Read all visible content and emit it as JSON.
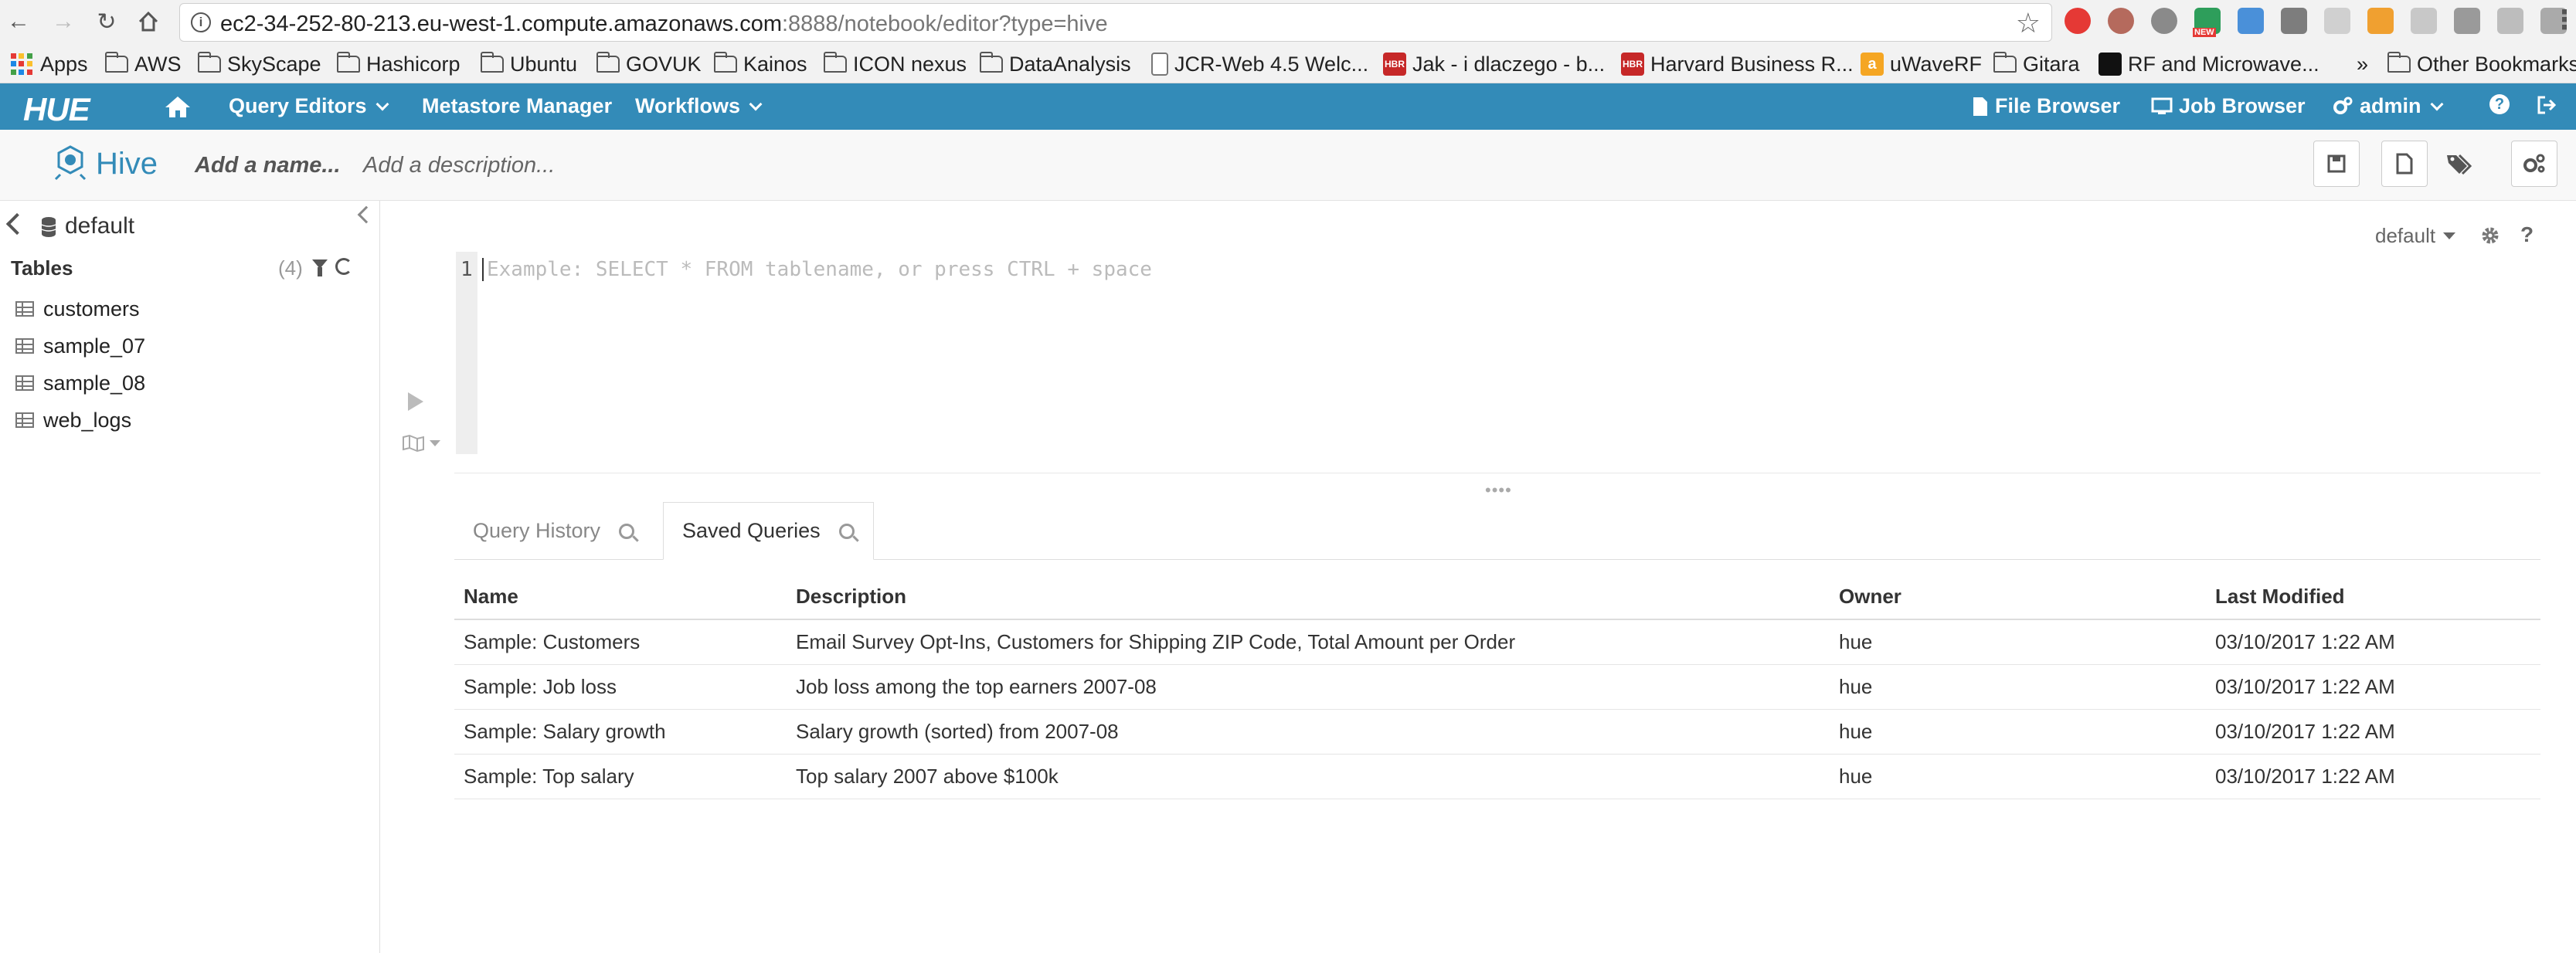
{
  "browser": {
    "url_host": "ec2-34-252-80-213.eu-west-1.compute.amazonaws.com",
    "url_rest": ":8888/notebook/editor?type=hive",
    "bookmarks": [
      {
        "label": "Apps",
        "kind": "apps"
      },
      {
        "label": "AWS",
        "kind": "folder"
      },
      {
        "label": "SkyScape",
        "kind": "folder"
      },
      {
        "label": "Hashicorp",
        "kind": "folder"
      },
      {
        "label": "Ubuntu",
        "kind": "folder"
      },
      {
        "label": "GOVUK",
        "kind": "folder"
      },
      {
        "label": "Kainos",
        "kind": "folder"
      },
      {
        "label": "ICON nexus",
        "kind": "folder"
      },
      {
        "label": "DataAnalysis",
        "kind": "folder"
      },
      {
        "label": "JCR-Web 4.5 Welc...",
        "kind": "page"
      },
      {
        "label": "Jak - i dlaczego - b...",
        "kind": "hbr"
      },
      {
        "label": "Harvard Business R...",
        "kind": "hbr"
      },
      {
        "label": "uWaveRF",
        "kind": "amazon"
      },
      {
        "label": "Gitara",
        "kind": "folder"
      },
      {
        "label": "RF and Microwave...",
        "kind": "dl"
      }
    ],
    "overflow": "»",
    "other_bookmarks": "Other Bookmarks",
    "hbr_badge": "HBR",
    "new_badge": "NEW"
  },
  "hue_nav": {
    "logo": "HUE",
    "query_editors": "Query Editors",
    "metastore_manager": "Metastore Manager",
    "workflows": "Workflows",
    "file_browser": "File Browser",
    "job_browser": "Job Browser",
    "user": "admin",
    "help": "?"
  },
  "editor_header": {
    "title": "Hive",
    "name_placeholder": "Add a name...",
    "description_placeholder": "Add a description..."
  },
  "assist": {
    "database": "default",
    "tables_title": "Tables",
    "tables_count": "(4)",
    "tables": [
      "customers",
      "sample_07",
      "sample_08",
      "web_logs"
    ]
  },
  "editor": {
    "database_selector": "default",
    "help": "?",
    "line_number": "1",
    "placeholder": "Example: SELECT * FROM tablename, or press CTRL + space"
  },
  "tabs": {
    "query_history": "Query History",
    "saved_queries": "Saved Queries"
  },
  "saved_queries": {
    "columns": [
      "Name",
      "Description",
      "Owner",
      "Last Modified"
    ],
    "rows": [
      [
        "Sample: Customers",
        "Email Survey Opt-Ins, Customers for Shipping ZIP Code, Total Amount per Order",
        "hue",
        "03/10/2017 1:22 AM"
      ],
      [
        "Sample: Job loss",
        "Job loss among the top earners 2007-08",
        "hue",
        "03/10/2017 1:22 AM"
      ],
      [
        "Sample: Salary growth",
        "Salary growth (sorted) from 2007-08",
        "hue",
        "03/10/2017 1:22 AM"
      ],
      [
        "Sample: Top salary",
        "Top salary 2007 above $100k",
        "hue",
        "03/10/2017 1:22 AM"
      ]
    ]
  },
  "colors": {
    "hue_blue": "#338bb8",
    "header_bg": "#f8f8f8"
  }
}
